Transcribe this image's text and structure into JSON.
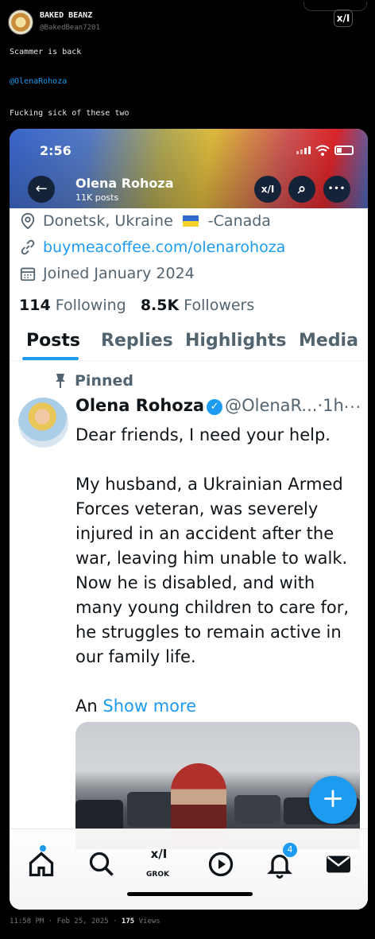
{
  "outer_tweet": {
    "author_name": "BAKED BEANZ",
    "author_handle": "@BakedBean7201",
    "grok_label": "x/I",
    "lines": [
      "Scammer is back",
      "@OlenaRohoza",
      "Fucking sick of these two"
    ],
    "time": "11:58 PM",
    "separator": "·",
    "date": "Feb 25, 2025",
    "views_count": "175",
    "views_label": "Views"
  },
  "phone": {
    "status_time": "2:56",
    "header": {
      "name": "Olena Rohoza",
      "posts": "11K posts",
      "back_icon": "←",
      "grok_icon": "x/I",
      "search_icon": "⌕",
      "more_icon": "•••"
    },
    "profile": {
      "location_prefix": "Donetsk, Ukraine",
      "location_suffix": "-Canada",
      "website": "buymeacoffee.com/olenarohoza",
      "joined": "Joined January 2024",
      "following_count": "114",
      "following_label": "Following",
      "followers_count": "8.5K",
      "followers_label": "Followers"
    },
    "tabs": [
      "Posts",
      "Replies",
      "Highlights",
      "Media"
    ],
    "active_tab": "Posts",
    "post": {
      "pinned_label": "Pinned",
      "author_name": "Olena Rohoza",
      "verified_mark": "✓",
      "author_handle": "@OlenaR...",
      "separator": "·",
      "time": "1h",
      "more": "···",
      "paragraph_1": "Dear friends, I need your help.",
      "paragraph_2": "My husband, a Ukrainian Armed Forces veteran, was severely injured in an accident after the war, leaving him unable to walk. Now he is disabled, and with many young children to care for, he struggles to remain active in our family life.",
      "paragraph_3_start": "An",
      "show_more": "Show more"
    },
    "fab_icon": "+",
    "nav": {
      "home_icon": "⌂",
      "search_icon": "⌕",
      "grok_icon": "x/I",
      "grok_label": "GROK",
      "video_icon": "▶",
      "notifications_icon": "♫",
      "notifications_badge": "4",
      "messages_icon": "✉"
    },
    "colors": {
      "accent": "#1d9bf0",
      "text": "#0f1419",
      "muted": "#536471"
    }
  }
}
